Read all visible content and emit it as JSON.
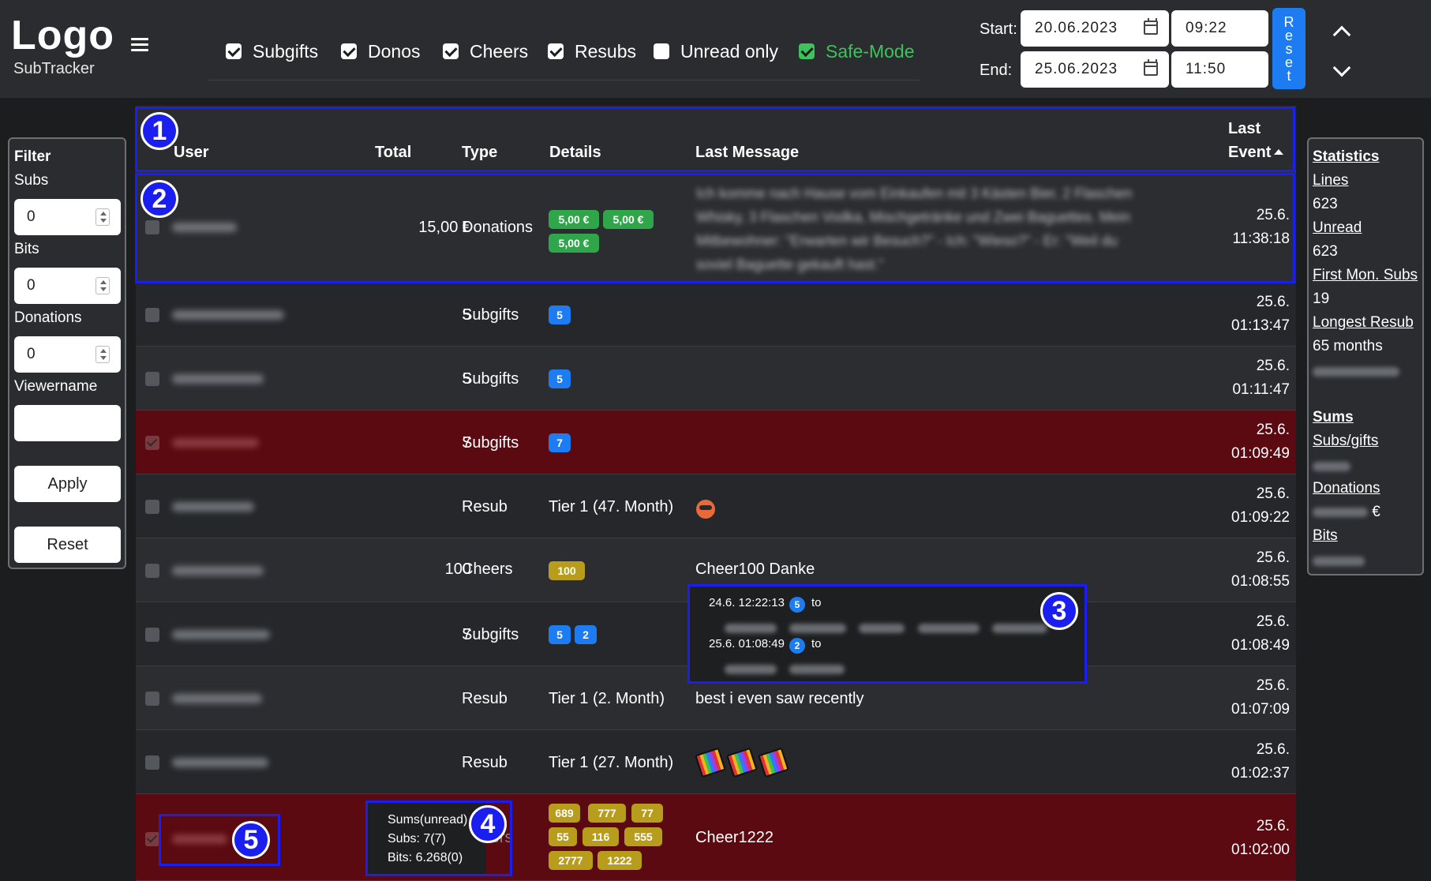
{
  "app": {
    "logo": "Logo",
    "subtitle": "SubTracker"
  },
  "toggles": [
    {
      "label": "Subgifts",
      "checked": true
    },
    {
      "label": "Donos",
      "checked": true
    },
    {
      "label": "Cheers",
      "checked": true
    },
    {
      "label": "Resubs",
      "checked": true
    },
    {
      "label": "Unread only",
      "checked": false
    },
    {
      "label": "Safe-Mode",
      "checked": true,
      "color": "#3cc35a"
    }
  ],
  "range": {
    "start_label": "Start:",
    "end_label": "End:",
    "start_date": "20.06.2023",
    "start_time": "09:22",
    "end_date": "25.06.2023",
    "end_time": "11:50",
    "reset_label": "Reset"
  },
  "filter": {
    "title": "Filter",
    "subs_label": "Subs",
    "subs_value": "0",
    "bits_label": "Bits",
    "bits_value": "0",
    "donations_label": "Donations",
    "donations_value": "0",
    "viewername_label": "Viewername",
    "viewername_value": "",
    "apply_label": "Apply",
    "reset_label": "Reset"
  },
  "stats": {
    "title": "Statistics",
    "lines_label": "Lines",
    "lines_value": "623",
    "unread_label": "Unread",
    "unread_value": "623",
    "first_mon_label": "First Mon. Subs",
    "first_mon_value": "19",
    "longest_label": "Longest Resub",
    "longest_value": "65 months",
    "sums_title": "Sums",
    "subs_gifts_label": "Subs/gifts",
    "donations_label": "Donations",
    "currency": "€",
    "bits_label": "Bits"
  },
  "table": {
    "headers": {
      "user": "User",
      "total": "Total",
      "type": "Type",
      "details": "Details",
      "last_message": "Last Message",
      "last": "Last",
      "event": "Event"
    },
    "rows": [
      {
        "total": "15,00 €",
        "type": "Donations",
        "badges": [
          "5,00 €",
          "5,00 €",
          "5,00 €"
        ],
        "message": "Ich komme nach Hause vom Einkaufen mit 3 Kästen Bier, 2 Flaschen Whisky, 3 Flaschen Vodka, Mischgetränke und Zwei Baguettes. Mein Mitbewohner: \"Erwarten wir Besuch?\" - Ich: \"Wieso?\" - Er: \"Weil du soviel Baguette gekauft hast.\"",
        "date": "25.6.",
        "time": "11:38:18"
      },
      {
        "total": "5",
        "type": "Subgifts",
        "badges": [
          "5"
        ],
        "message": "",
        "date": "25.6.",
        "time": "01:13:47"
      },
      {
        "total": "5",
        "type": "Subgifts",
        "badges": [
          "5"
        ],
        "message": "",
        "date": "25.6.",
        "time": "01:11:47"
      },
      {
        "total": "7",
        "type": "Subgifts",
        "badges": [
          "7"
        ],
        "message": "",
        "date": "25.6.",
        "time": "01:09:49"
      },
      {
        "total": "",
        "type": "Resub",
        "details": "Tier 1 (47. Month)",
        "message": "",
        "date": "25.6.",
        "time": "01:09:22"
      },
      {
        "total": "100",
        "type": "Cheers",
        "badges": [
          "100"
        ],
        "message": "Cheer100 Danke",
        "date": "25.6.",
        "time": "01:08:55"
      },
      {
        "total": "7",
        "type": "Subgifts",
        "badges": [
          "5",
          "2"
        ],
        "message": "",
        "date": "25.6.",
        "time": "01:08:49"
      },
      {
        "total": "",
        "type": "Resub",
        "details": "Tier 1 (2. Month)",
        "message": "best i even saw recently",
        "date": "25.6.",
        "time": "01:07:09"
      },
      {
        "total": "",
        "type": "Resub",
        "details": "Tier 1 (27. Month)",
        "message": "",
        "date": "25.6.",
        "time": "01:02:37"
      },
      {
        "total": "",
        "type": "Cheers",
        "badges": [
          "689",
          "777",
          "77",
          "55",
          "116",
          "555",
          "2777",
          "1222"
        ],
        "message": "Cheer1222",
        "date": "25.6.",
        "time": "01:02:00"
      }
    ]
  },
  "tooltip_gifts": {
    "line1_time": "24.6. 12:22:13",
    "line1_badge": "5",
    "line1_to": "to",
    "line2_time": "25.6. 01:08:49",
    "line2_badge": "2",
    "line2_to": "to"
  },
  "tooltip_sums": {
    "title": "Sums(unread)",
    "subs": "Subs: 7(7)",
    "bits": "Bits: 6.268(0)"
  },
  "annotations": [
    "1",
    "2",
    "3",
    "4",
    "5"
  ]
}
